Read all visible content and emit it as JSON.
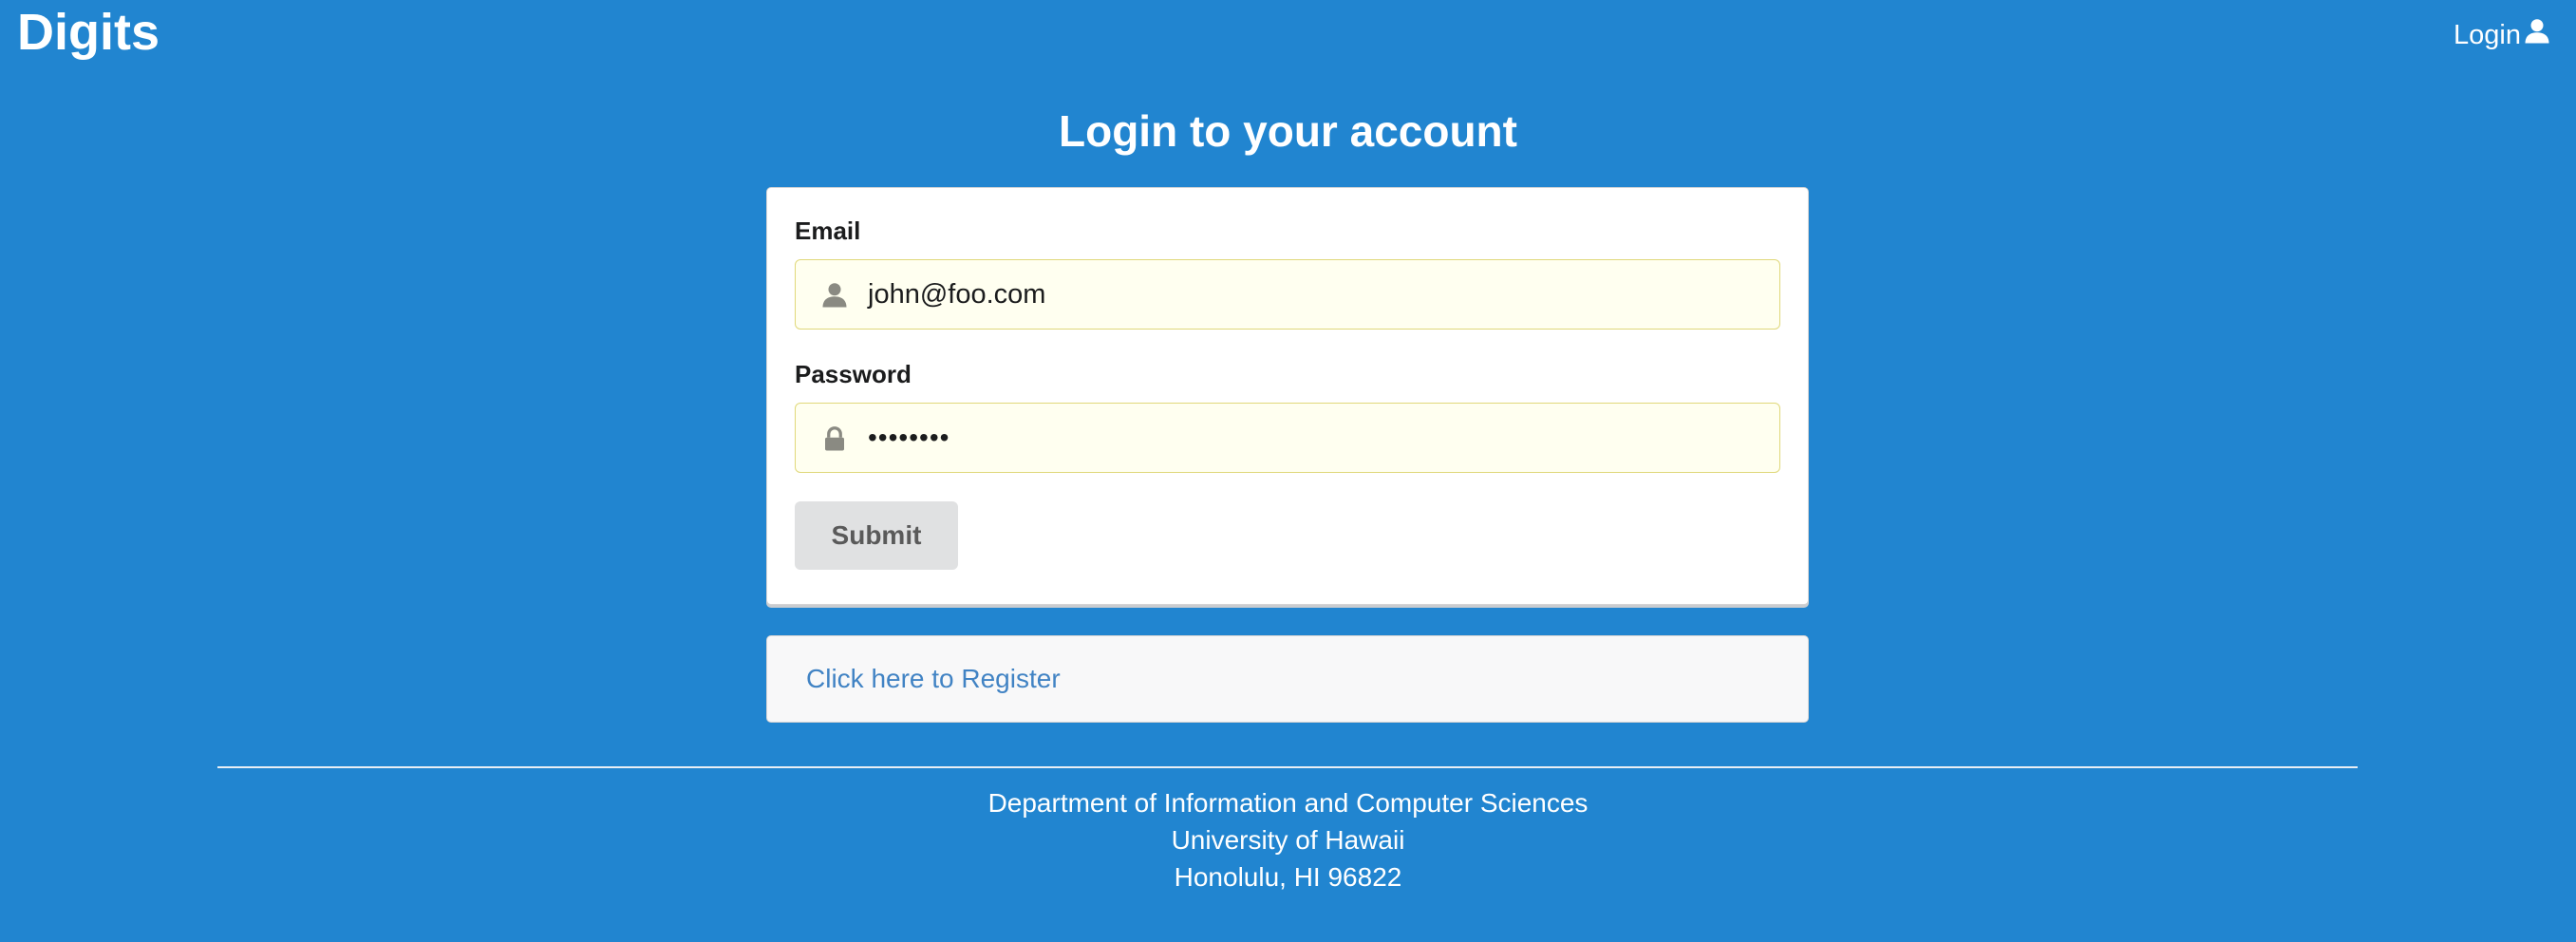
{
  "navbar": {
    "brand": "Digits",
    "login_label": "Login",
    "login_icon": "user-icon"
  },
  "page": {
    "title": "Login to your account"
  },
  "form": {
    "email_label": "Email",
    "email_value": "john@foo.com",
    "email_icon": "user-icon",
    "password_label": "Password",
    "password_value": "••••••••",
    "password_icon": "lock-icon",
    "submit_label": "Submit"
  },
  "register": {
    "link_label": "Click here to Register"
  },
  "footer": {
    "line1": "Department of Information and Computer Sciences",
    "line2": "University of Hawaii",
    "line3": "Honolulu, HI 96822"
  },
  "colors": {
    "background": "#2185d0",
    "input_background": "#fffff0",
    "input_border": "#e0d87a",
    "button_background": "#e0e1e2",
    "link": "#4183c4"
  }
}
